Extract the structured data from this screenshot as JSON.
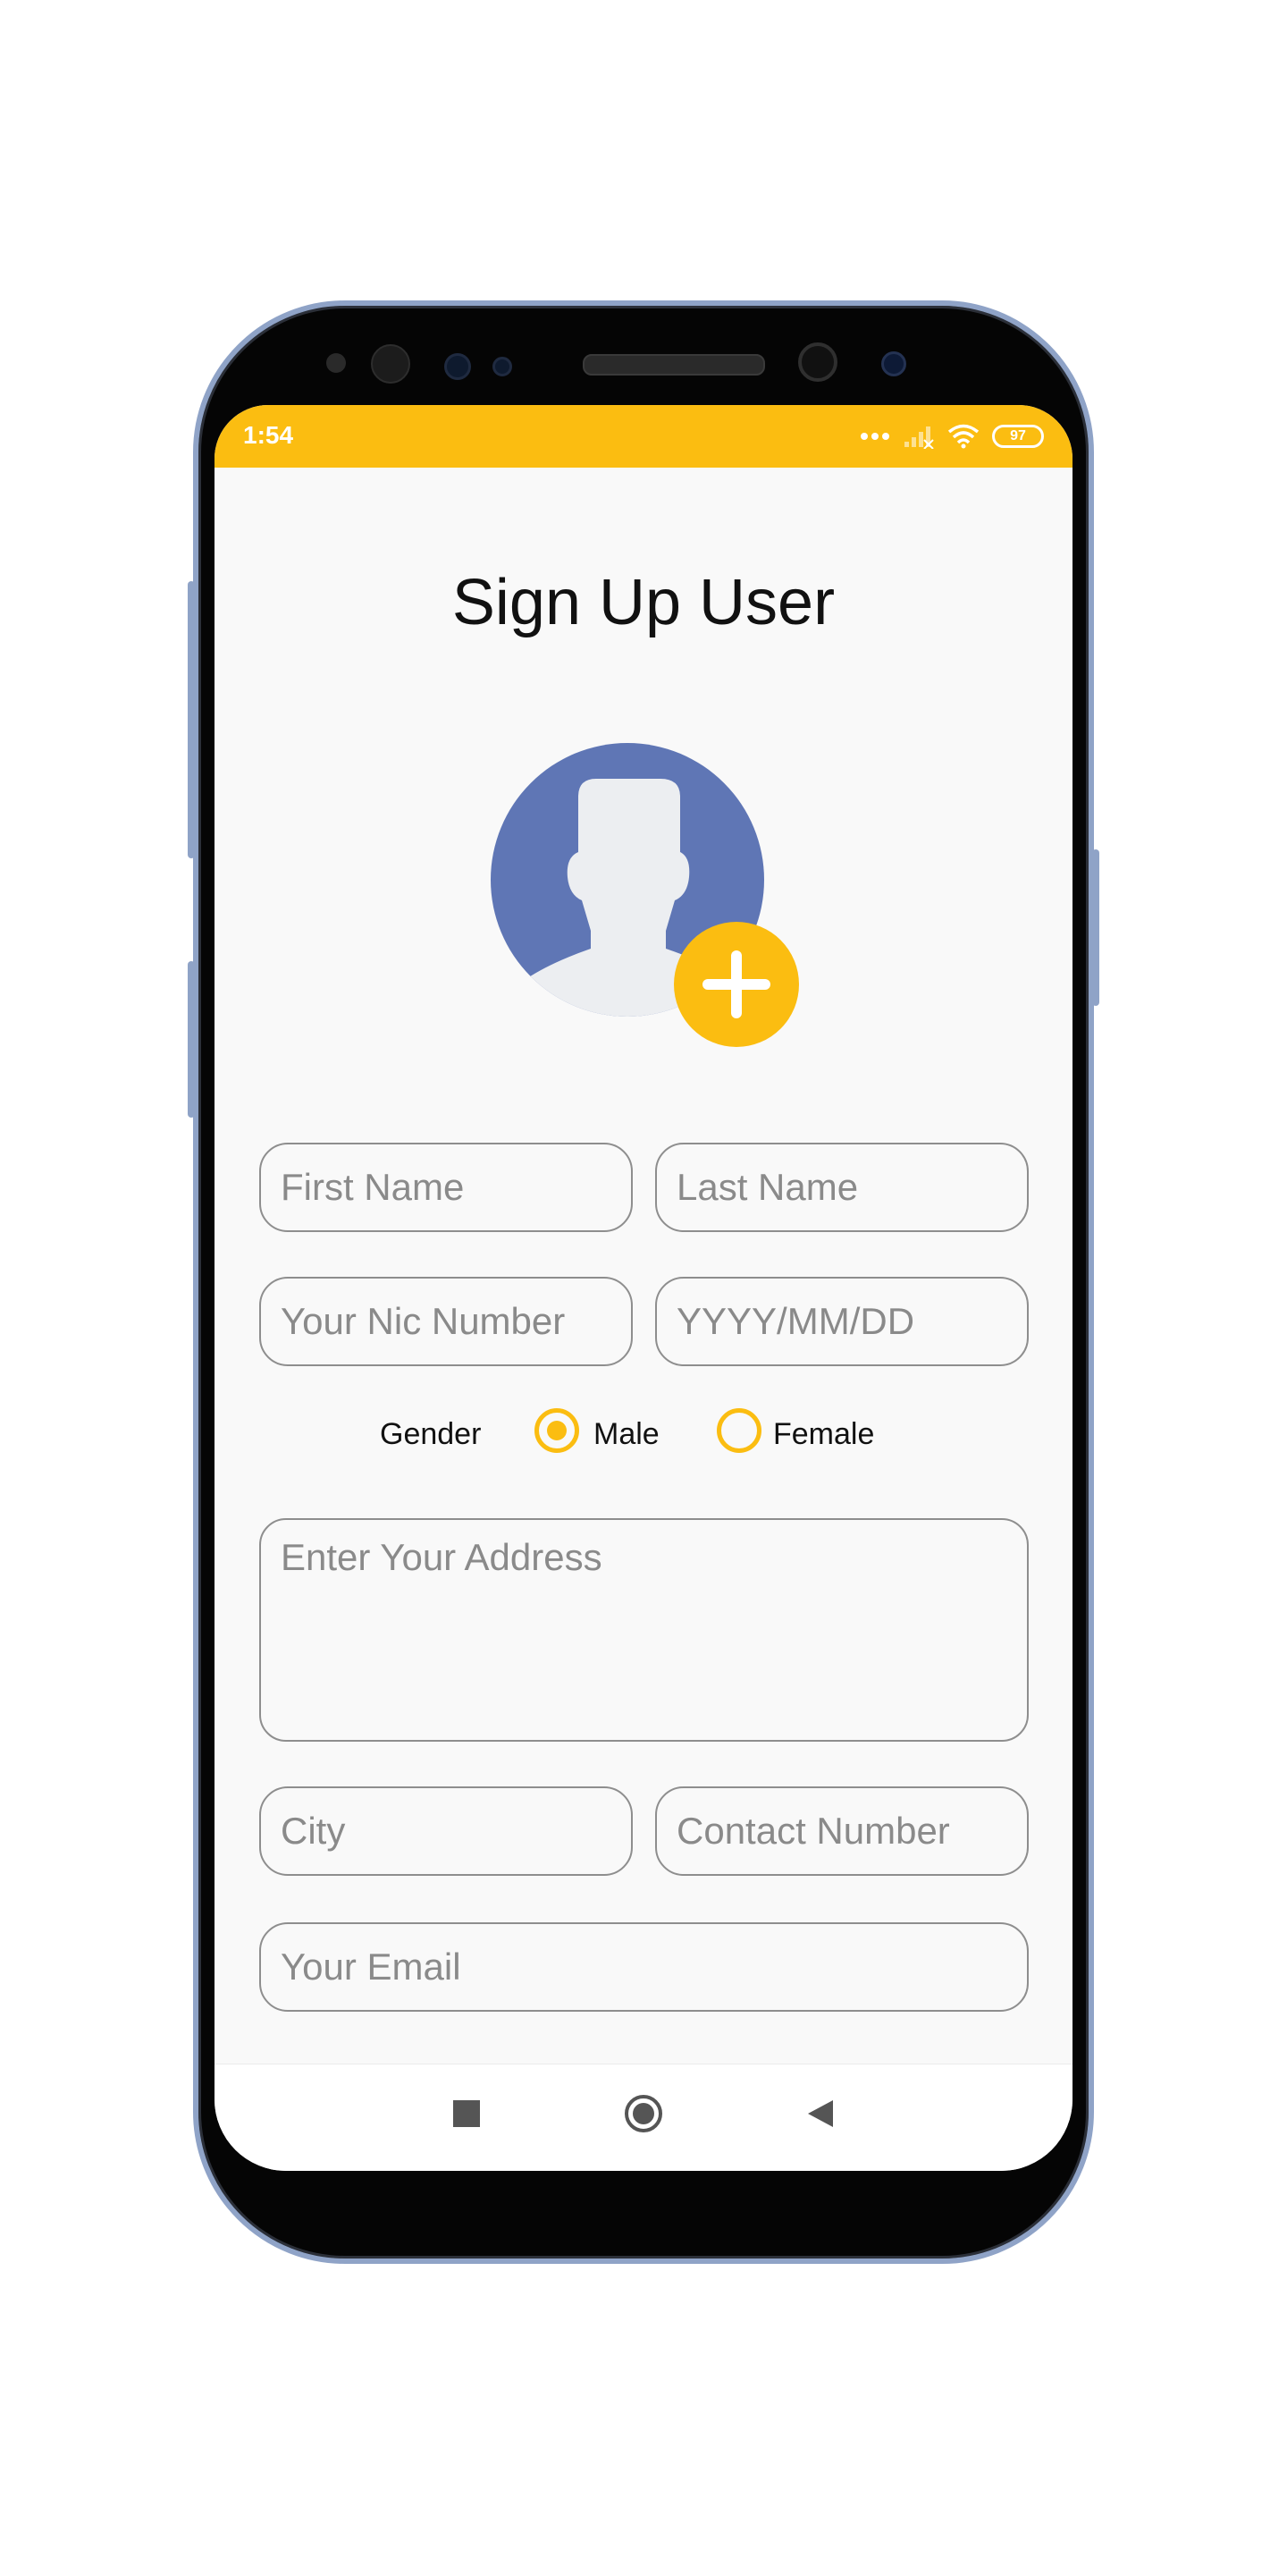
{
  "statusbar": {
    "time": "1:54",
    "battery": "97",
    "icons": [
      "dots-icon",
      "signal-icon",
      "wifi-icon",
      "battery-icon"
    ]
  },
  "page": {
    "title": "Sign Up User"
  },
  "avatar": {
    "icon": "user-silhouette-icon",
    "add_icon": "plus-icon"
  },
  "form": {
    "first_name": {
      "placeholder": "First Name",
      "value": ""
    },
    "last_name": {
      "placeholder": "Last Name",
      "value": ""
    },
    "nic": {
      "placeholder": "Your Nic Number",
      "value": ""
    },
    "dob": {
      "placeholder": "YYYY/MM/DD",
      "value": ""
    },
    "gender": {
      "label": "Gender",
      "options": [
        "Male",
        "Female"
      ],
      "selected": "Male"
    },
    "address": {
      "placeholder": "Enter Your Address",
      "value": ""
    },
    "city": {
      "placeholder": "City",
      "value": ""
    },
    "contact": {
      "placeholder": "Contact Number",
      "value": ""
    },
    "email": {
      "placeholder": "Your Email",
      "value": ""
    }
  },
  "navbar": {
    "icons": [
      "square-recents-icon",
      "circle-home-icon",
      "triangle-back-icon"
    ]
  },
  "colors": {
    "accent": "#fbbd11",
    "avatar_bg": "#5f76b5",
    "border": "#8e8e8e",
    "placeholder": "#8a8a8a",
    "frame": "#8fa3c7"
  }
}
